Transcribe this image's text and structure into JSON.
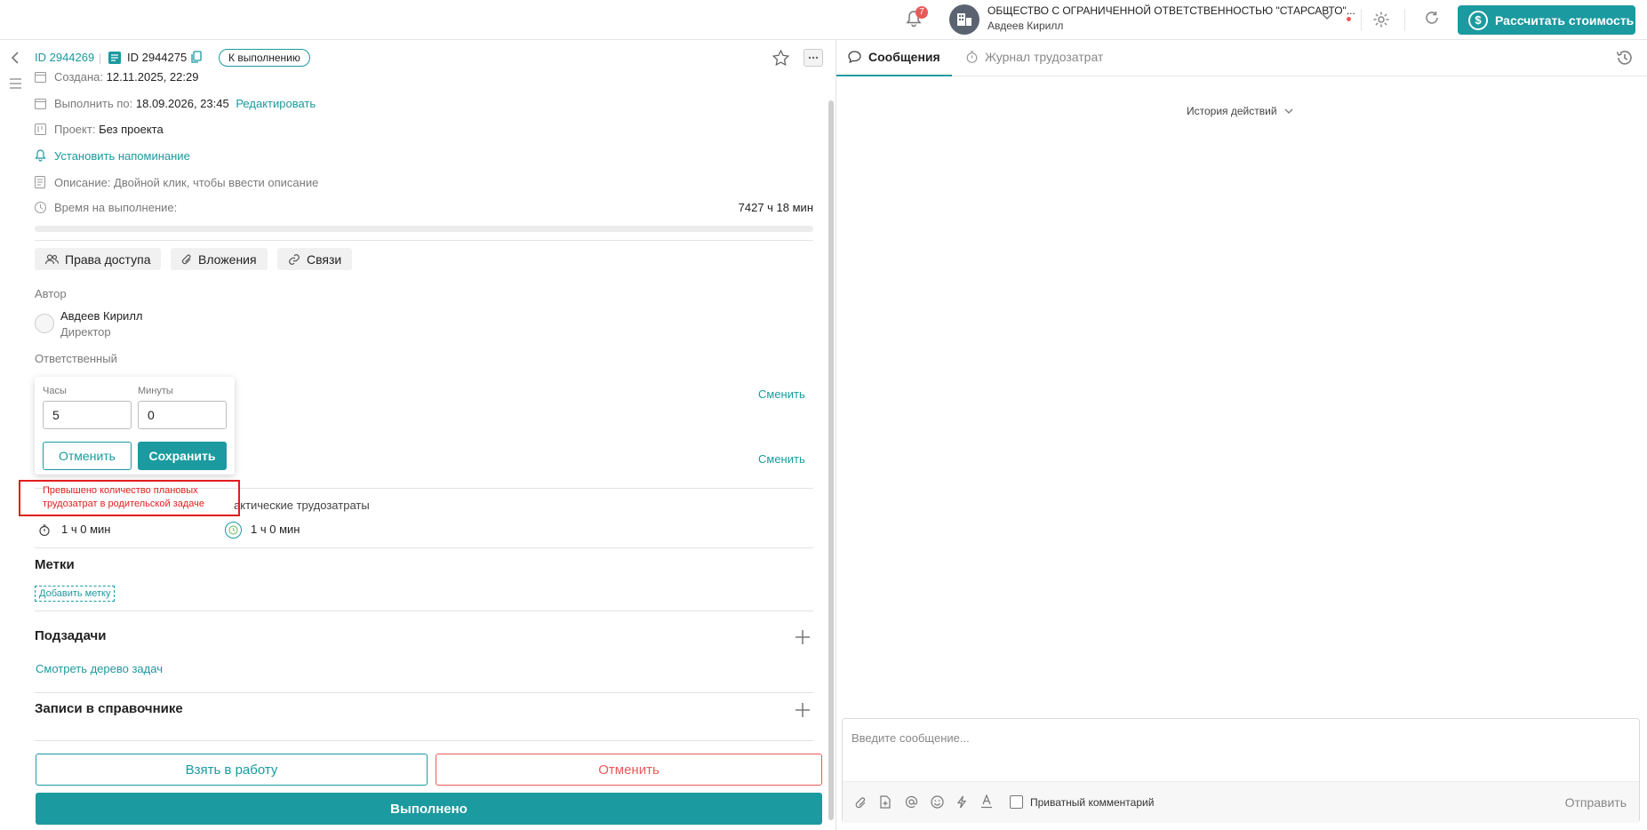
{
  "topbar": {
    "notifications_count": "7",
    "org_name": "ОБЩЕСТВО С ОГРАНИЧЕННОЙ ОТВЕТСТВЕННОСТЬЮ \"СТАРСАВТО\"...",
    "org_user": "Авдеев Кирилл",
    "calc_button": "Рассчитать стоимость"
  },
  "task": {
    "id_link": "ID 2944269",
    "id_current": "ID 2944275",
    "status": "К выполнению",
    "created_label": "Создана:",
    "created_value": "12.11.2025, 22:29",
    "deadline_label": "Выполнить по:",
    "deadline_value": "18.09.2026, 23:45",
    "edit_link": "Редактировать",
    "project_label": "Проект:",
    "project_value": "Без проекта",
    "reminder_link": "Установить напоминание",
    "description_placeholder": "Описание: Двойной клик, чтобы ввести описание",
    "time_label": "Время на выполнение:",
    "time_value": "7427 ч 18 мин"
  },
  "tag_buttons": {
    "access": "Права доступа",
    "attachments": "Вложения",
    "links": "Связи"
  },
  "people": {
    "author_label": "Автор",
    "author_name": "Авдеев Кирилл",
    "author_role": "Директор",
    "responsible_label": "Ответственный",
    "change1": "Сменить",
    "change2": "Сменить"
  },
  "time_popup": {
    "hours_label": "Часы",
    "hours_value": "5",
    "minutes_label": "Минуты",
    "minutes_value": "0",
    "cancel": "Отменить",
    "save": "Сохранить",
    "error_line1": "Превышено количество плановых",
    "error_line2": "трудозатрат в родительской задаче"
  },
  "effort": {
    "actual_label_partial": "актические трудозатраты",
    "planned_value": "1 ч 0 мин",
    "actual_value": "1 ч 0 мин"
  },
  "labels_section": {
    "title": "Метки",
    "add": "Добавить метку"
  },
  "subtasks": {
    "title": "Подзадачи",
    "tree_link": "Смотреть дерево задач"
  },
  "directory": {
    "title": "Записи в справочнике"
  },
  "actions": {
    "take": "Взять в работу",
    "cancel": "Отменить",
    "done": "Выполнено"
  },
  "right_panel": {
    "tab_messages": "Сообщения",
    "tab_journal": "Журнал трудозатрат",
    "history": "История действий",
    "message_placeholder": "Введите сообщение...",
    "private_comment": "Приватный комментарий",
    "send": "Отправить"
  },
  "colors": {
    "accent": "#1b9aa0",
    "danger": "#e85a5a",
    "error": "#e01e1e"
  }
}
